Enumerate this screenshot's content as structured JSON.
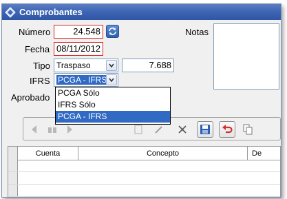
{
  "window": {
    "title": "Comprobantes"
  },
  "form": {
    "numero_label": "Número",
    "numero_value": "24.548",
    "fecha_label": "Fecha",
    "fecha_value": "08/11/2012",
    "tipo_label": "Tipo",
    "tipo_value": "Traspaso",
    "tipo_amount": "7.688",
    "ifrs_label": "IFRS",
    "ifrs_value": "PCGA - IFRS",
    "aprobado_label": "Aprobado",
    "notas_label": "Notas"
  },
  "dropdown": {
    "options": [
      "PCGA Sólo",
      "IFRS Sólo",
      "PCGA - IFRS"
    ],
    "selected_index": 2
  },
  "grid": {
    "columns": [
      "Cuenta",
      "Concepto",
      "De"
    ]
  },
  "colors": {
    "titlebar": "#3f66b4",
    "error_border": "#d42020",
    "selection": "#316ac5"
  },
  "icons": {
    "refresh": "refresh-icon",
    "first": "first-record-icon",
    "prev": "prev-record-icon",
    "next": "next-record-icon",
    "delete": "delete-icon",
    "save": "save-icon",
    "undo": "undo-icon",
    "copy": "copy-icon"
  }
}
